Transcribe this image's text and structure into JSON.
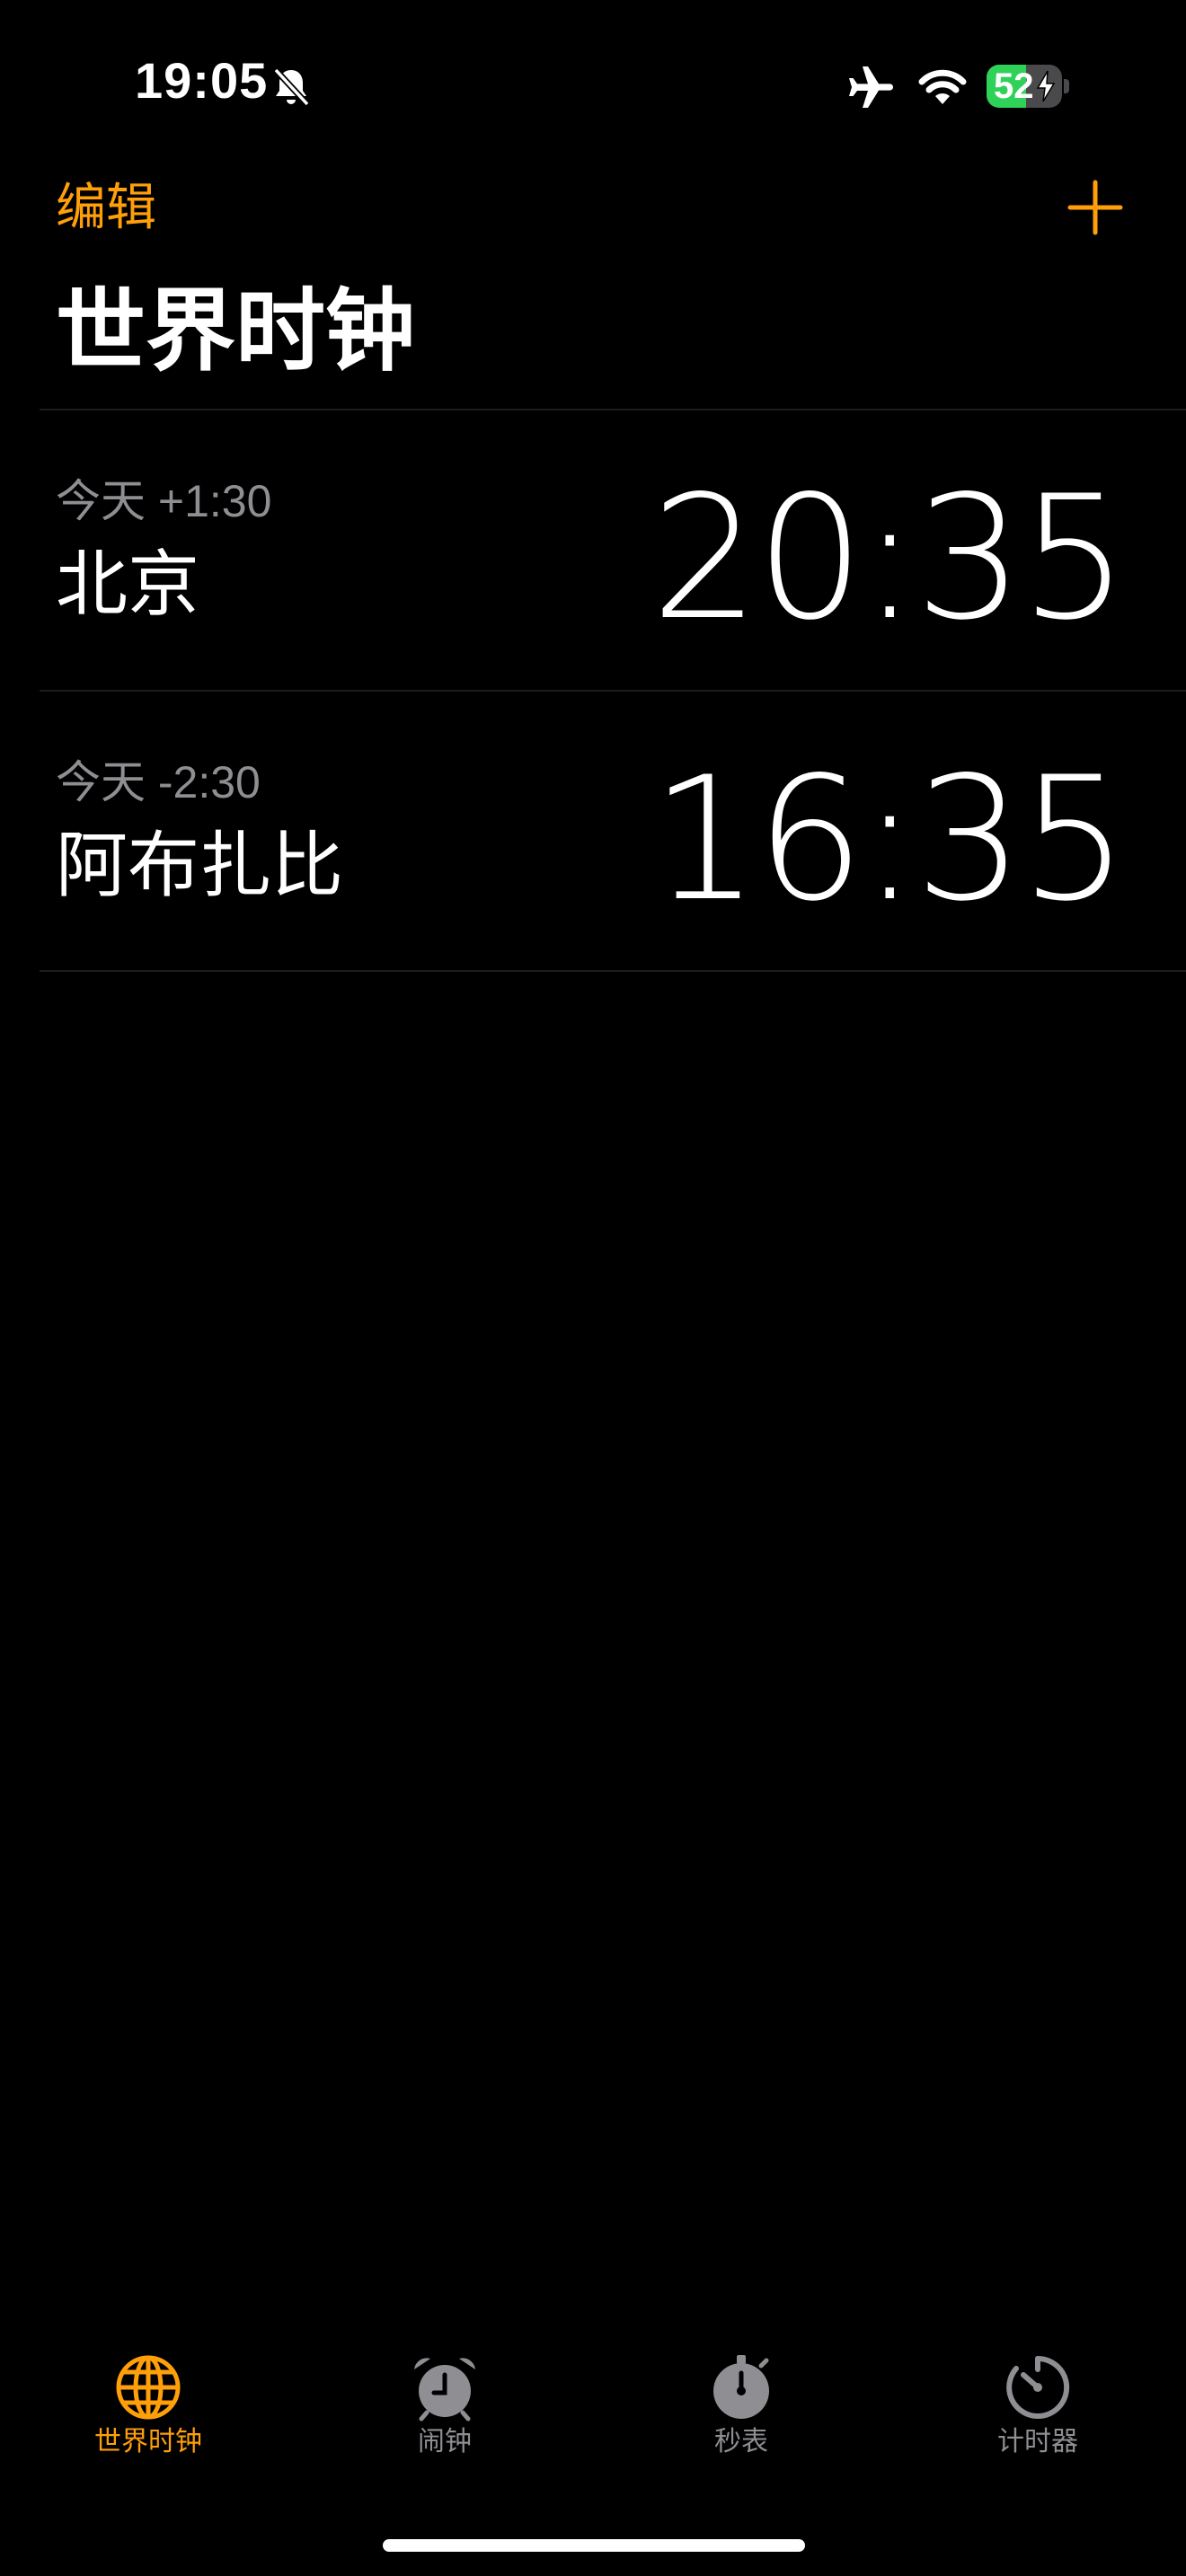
{
  "status_bar": {
    "time": "19:05",
    "battery_level": "52",
    "battery_fraction": 0.52,
    "icons": [
      "bell-off-icon",
      "airplane-icon",
      "wifi-icon",
      "battery-charging-icon"
    ]
  },
  "header": {
    "edit_label": "编辑",
    "add_icon": "plus-icon",
    "title": "世界时钟"
  },
  "clocks": [
    {
      "offset": "今天 +1:30",
      "city": "北京",
      "time": "20:35"
    },
    {
      "offset": "今天 -2:30",
      "city": "阿布扎比",
      "time": "16:35"
    }
  ],
  "tabs": [
    {
      "label": "世界时钟",
      "icon": "globe-icon",
      "active": true
    },
    {
      "label": "闹钟",
      "icon": "alarm-clock-icon",
      "active": false
    },
    {
      "label": "秒表",
      "icon": "stopwatch-icon",
      "active": false
    },
    {
      "label": "计时器",
      "icon": "timer-icon",
      "active": false
    }
  ],
  "colors": {
    "accent": "#ff9f0a",
    "background": "#000000",
    "secondary_text": "#8e8e93",
    "battery_green": "#30d158"
  }
}
